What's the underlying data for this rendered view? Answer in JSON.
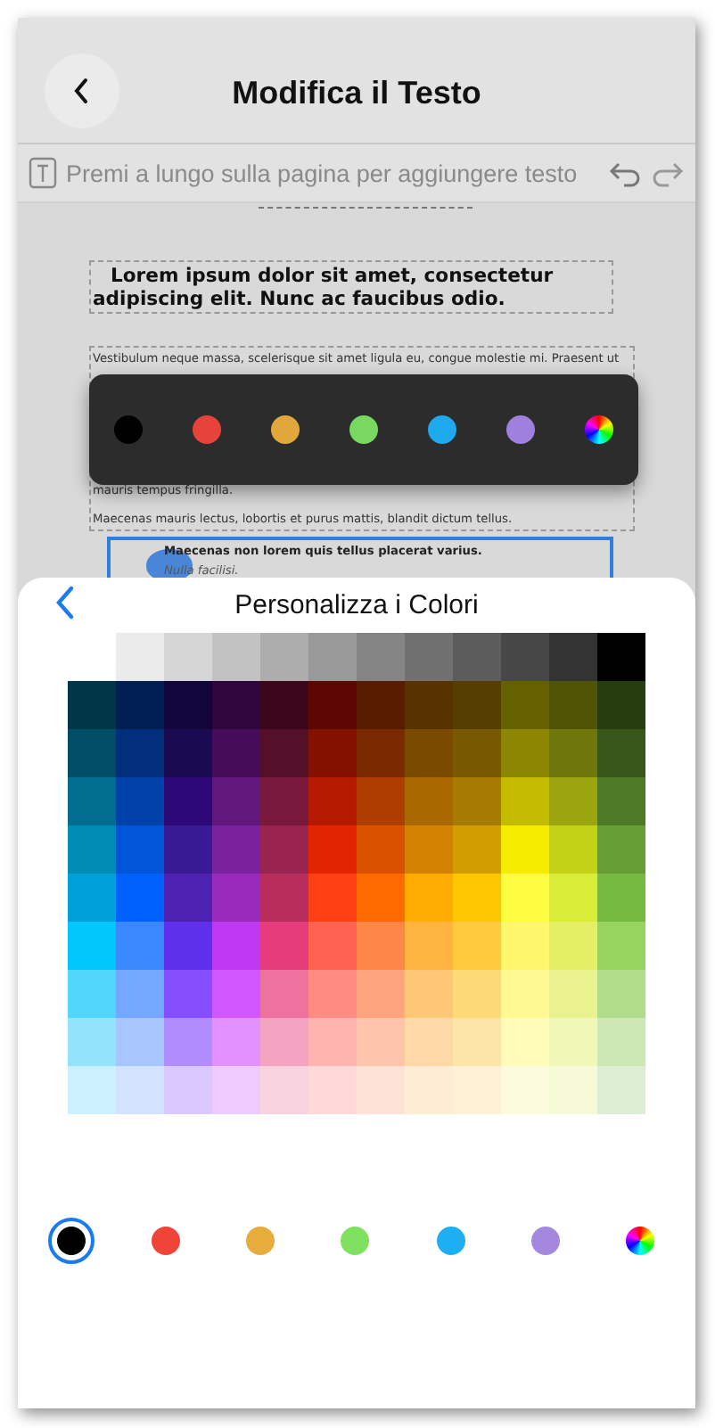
{
  "header": {
    "title": "Modifica il Testo"
  },
  "hint": {
    "text": "Premi a lungo sulla pagina per aggiungere testo"
  },
  "document": {
    "heading": "Lorem ipsum dolor sit amet, consectetur adipiscing elit. Nunc ac faucibus odio.",
    "paragraph_lines": [
      "Vestibulum neque massa, scelerisque sit amet ligula eu, congue molestie mi. Praesent ut",
      "mauris tempus fringilla.",
      "Maecenas mauris lectus, lobortis et purus mattis, blandit dictum tellus."
    ],
    "bullets": [
      {
        "text": "Maecenas non lorem quis tellus placerat varius.",
        "kind": "bold"
      },
      {
        "text": "Nulla facilisi.",
        "kind": "italic"
      }
    ]
  },
  "quick_palette": [
    {
      "kind": "color",
      "color": "#000000"
    },
    {
      "kind": "color",
      "color": "#e8433a"
    },
    {
      "kind": "color",
      "color": "#e0a83a"
    },
    {
      "kind": "color",
      "color": "#78d860"
    },
    {
      "kind": "color",
      "color": "#1ea8ee"
    },
    {
      "kind": "color",
      "color": "#a080de"
    },
    {
      "kind": "spectrum"
    }
  ],
  "sheet": {
    "title": "Personalizza i Colori",
    "grid": [
      {
        "cells": [
          {
            "color": "#ebebeb"
          },
          {
            "color": "#d6d6d6"
          },
          {
            "color": "#c2c2c2"
          },
          {
            "color": "#adadad"
          },
          {
            "color": "#999999"
          },
          {
            "color": "#858585"
          },
          {
            "color": "#707070"
          },
          {
            "color": "#5c5c5c"
          },
          {
            "color": "#474747"
          },
          {
            "color": "#333333"
          },
          {
            "color": "#000000"
          }
        ]
      },
      {
        "cells": [
          {
            "color": "#003748"
          },
          {
            "color": "#021f54"
          },
          {
            "color": "#11053b"
          },
          {
            "color": "#2e063d"
          },
          {
            "color": "#3c071b"
          },
          {
            "color": "#5c0701"
          },
          {
            "color": "#5a1c00"
          },
          {
            "color": "#583300"
          },
          {
            "color": "#563d00"
          },
          {
            "color": "#666100"
          },
          {
            "color": "#4f5504"
          },
          {
            "color": "#263e0f"
          }
        ]
      },
      {
        "cells": [
          {
            "color": "#004d65"
          },
          {
            "color": "#012f7b"
          },
          {
            "color": "#1a0a52"
          },
          {
            "color": "#450d59"
          },
          {
            "color": "#551029"
          },
          {
            "color": "#831100"
          },
          {
            "color": "#7b2900"
          },
          {
            "color": "#7a4a00"
          },
          {
            "color": "#785800"
          },
          {
            "color": "#8c8602"
          },
          {
            "color": "#6f760a"
          },
          {
            "color": "#38571a"
          }
        ]
      },
      {
        "cells": [
          {
            "color": "#016e8f"
          },
          {
            "color": "#0042a9"
          },
          {
            "color": "#2c0977"
          },
          {
            "color": "#61187c"
          },
          {
            "color": "#791a3d"
          },
          {
            "color": "#b51a00"
          },
          {
            "color": "#ad3e00"
          },
          {
            "color": "#a96800"
          },
          {
            "color": "#a67b01"
          },
          {
            "color": "#c4bc00"
          },
          {
            "color": "#9ba50e"
          },
          {
            "color": "#4e7a27"
          }
        ]
      },
      {
        "cells": [
          {
            "color": "#008cb4"
          },
          {
            "color": "#0056d6"
          },
          {
            "color": "#371a94"
          },
          {
            "color": "#7a219e"
          },
          {
            "color": "#99244f"
          },
          {
            "color": "#e22400"
          },
          {
            "color": "#da5100"
          },
          {
            "color": "#d38301"
          },
          {
            "color": "#d19d01"
          },
          {
            "color": "#f5ec00"
          },
          {
            "color": "#c3d117"
          },
          {
            "color": "#669d34"
          }
        ]
      },
      {
        "cells": [
          {
            "color": "#00a1d8"
          },
          {
            "color": "#0061fe"
          },
          {
            "color": "#4d22b2"
          },
          {
            "color": "#982abc"
          },
          {
            "color": "#b92d5d"
          },
          {
            "color": "#ff4015"
          },
          {
            "color": "#ff6a00"
          },
          {
            "color": "#ffab01"
          },
          {
            "color": "#fcc700"
          },
          {
            "color": "#fefb41"
          },
          {
            "color": "#d9ec37"
          },
          {
            "color": "#76bb40"
          }
        ]
      },
      {
        "cells": [
          {
            "color": "#01c7fc"
          },
          {
            "color": "#3a87fe"
          },
          {
            "color": "#5e30eb"
          },
          {
            "color": "#be38f3"
          },
          {
            "color": "#e63b7a"
          },
          {
            "color": "#fe6250"
          },
          {
            "color": "#fe8648"
          },
          {
            "color": "#feb43f"
          },
          {
            "color": "#fecb3e"
          },
          {
            "color": "#fff76b"
          },
          {
            "color": "#e4ef65"
          },
          {
            "color": "#96d35f"
          }
        ]
      },
      {
        "cells": [
          {
            "color": "#52d6fc"
          },
          {
            "color": "#74a7ff"
          },
          {
            "color": "#864ffe"
          },
          {
            "color": "#d357fe"
          },
          {
            "color": "#ee719e"
          },
          {
            "color": "#ff8c82"
          },
          {
            "color": "#fea57d"
          },
          {
            "color": "#fec777"
          },
          {
            "color": "#fed977"
          },
          {
            "color": "#fff994"
          },
          {
            "color": "#eaf28f"
          },
          {
            "color": "#b1dd8b"
          }
        ]
      },
      {
        "cells": [
          {
            "color": "#93e3fc"
          },
          {
            "color": "#a7c6ff"
          },
          {
            "color": "#b18cfe"
          },
          {
            "color": "#e292fe"
          },
          {
            "color": "#f4a4c0"
          },
          {
            "color": "#ffb5af"
          },
          {
            "color": "#ffc5ab"
          },
          {
            "color": "#fed9a8"
          },
          {
            "color": "#fde4a8"
          },
          {
            "color": "#fffbb9"
          },
          {
            "color": "#f1f7b7"
          },
          {
            "color": "#cde8b5"
          }
        ]
      },
      {
        "cells": [
          {
            "color": "#cbf0ff"
          },
          {
            "color": "#d3e2ff"
          },
          {
            "color": "#d9c9fe"
          },
          {
            "color": "#efcafe"
          },
          {
            "color": "#f9d3e0"
          },
          {
            "color": "#ffdad8"
          },
          {
            "color": "#ffe2d6"
          },
          {
            "color": "#feecd4"
          },
          {
            "color": "#fef1d5"
          },
          {
            "color": "#fdfbdd"
          },
          {
            "color": "#f6fad6"
          },
          {
            "color": "#deeed4"
          }
        ]
      }
    ],
    "swatches": [
      {
        "kind": "color",
        "color": "#000000",
        "selected": true
      },
      {
        "kind": "color",
        "color": "#f04438",
        "selected": false
      },
      {
        "kind": "color",
        "color": "#e6ac3c",
        "selected": false
      },
      {
        "kind": "color",
        "color": "#80e060",
        "selected": false
      },
      {
        "kind": "color",
        "color": "#1eaef2",
        "selected": false
      },
      {
        "kind": "color",
        "color": "#a488e0",
        "selected": false
      },
      {
        "kind": "spectrum",
        "selected": false
      }
    ]
  }
}
